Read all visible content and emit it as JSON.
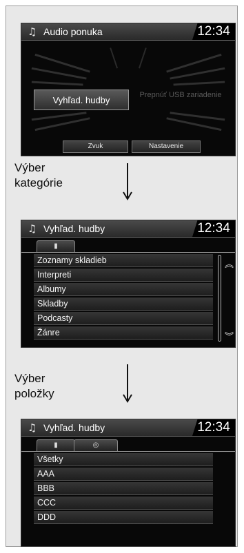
{
  "audio_menu": {
    "title": "Audio ponuka",
    "clock": "12:34",
    "search_button": "Vyhľad. hudby",
    "switch_usb_button": "Prepnúť USB zariadenie",
    "sound_button": "Zvuk",
    "settings_button": "Nastavenie"
  },
  "step1": {
    "line1": "Výber",
    "line2": "kategórie"
  },
  "category_screen": {
    "title": "Vyhľad. hudby",
    "clock": "12:34",
    "items": [
      "Zoznamy skladieb",
      "Interpreti",
      "Albumy",
      "Skladby",
      "Podcasty",
      "Žánre"
    ]
  },
  "step2": {
    "line1": "Výber",
    "line2": "položky"
  },
  "item_screen": {
    "title": "Vyhľad. hudby",
    "clock": "12:34",
    "items": [
      "Všetky",
      "AAA",
      "BBB",
      "CCC",
      "DDD"
    ]
  },
  "icons": {
    "header": "music-note-icon",
    "tab_usb": "usb-device-icon",
    "tab_disc": "disc-icon"
  },
  "colors": {
    "screen_bg": "#080808",
    "panel_bg": "#e8e8e8",
    "text": "#ffffff"
  }
}
